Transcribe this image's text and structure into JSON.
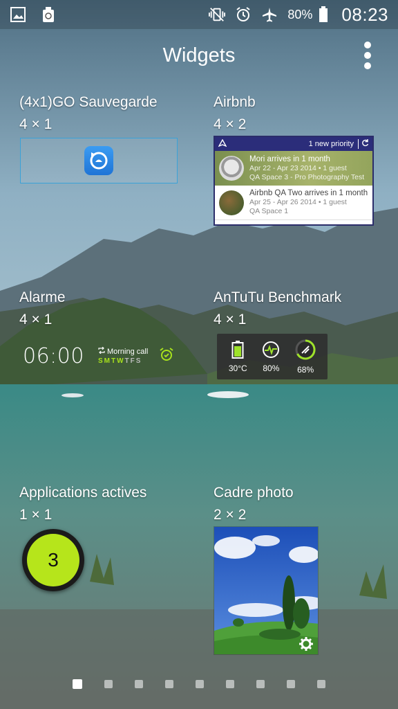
{
  "status_bar": {
    "left_icons": [
      "image-icon",
      "recycle-icon"
    ],
    "right_icons": [
      "vibrate-icon",
      "alarm-icon",
      "airplane-icon",
      "battery-icon"
    ],
    "battery_percent": "80%",
    "time": "08:23"
  },
  "header": {
    "title": "Widgets",
    "menu_icon": "overflow-menu-icon"
  },
  "widgets": [
    {
      "name": "(4x1)GO Sauvegarde",
      "size": "4 × 1"
    },
    {
      "name": "Airbnb",
      "size": "4 × 2"
    },
    {
      "name": "Alarme",
      "size": "4 × 1"
    },
    {
      "name": "AnTuTu Benchmark",
      "size": "4 × 1"
    },
    {
      "name": "Applications actives",
      "size": "1 × 1"
    },
    {
      "name": "Cadre photo",
      "size": "2 × 2"
    }
  ],
  "airbnb_preview": {
    "priority": "1 new priority",
    "items": [
      {
        "title": "Mori arrives in 1 month",
        "dates": "Apr 22 - Apr 23 2014 • 1 guest",
        "place": "QA Space 3 - Pro Photography Test"
      },
      {
        "title": "Airbnb QA Two arrives in 1 month",
        "dates": "Apr 25 - Apr 26 2014 • 1 guest",
        "place": "QA Space 1"
      }
    ]
  },
  "alarm_preview": {
    "time": "06:00",
    "label": "Morning call",
    "days": [
      {
        "d": "S",
        "on": true
      },
      {
        "d": "M",
        "on": true
      },
      {
        "d": "T",
        "on": true
      },
      {
        "d": "W",
        "on": true
      },
      {
        "d": "T",
        "on": false
      },
      {
        "d": "F",
        "on": false
      },
      {
        "d": "S",
        "on": false
      }
    ]
  },
  "antutu_preview": {
    "temperature": "30°C",
    "cpu": "80%",
    "ram": "68%"
  },
  "running_apps": {
    "count": "3"
  },
  "page_indicator": {
    "pages": 9,
    "active": 0
  },
  "colors": {
    "accent_green": "#b6e51b",
    "airbnb_bar": "#2b2d7a",
    "go_border": "#3aa2d8"
  }
}
